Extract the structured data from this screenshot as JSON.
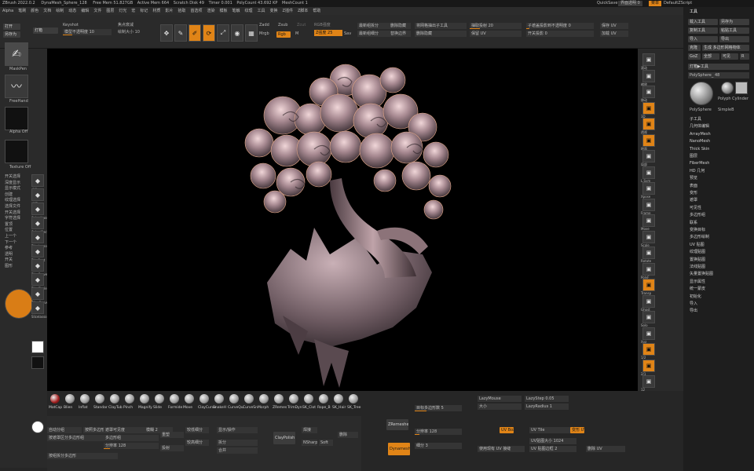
{
  "titlebar": {
    "app": "ZBrush 2022.0.2",
    "project": "DynaMesh_Sphere_128",
    "free_mem": "Free Mem 51.827GB",
    "active_mem": "Active Mem 664",
    "scratch": "Scratch Disk 49",
    "timer": "Timer 0.001",
    "polycount": "PolyCount 43.692 KP",
    "meshcount": "MeshCount 1",
    "quicksave": "QuickSave",
    "transparency": "界面透明 0",
    "menus_btn": "菜单",
    "script": "DefaultZScript"
  },
  "menubar": [
    "Alpha",
    "笔刷",
    "颜色",
    "文档",
    "绘制",
    "动态",
    "编辑",
    "文件",
    "图层",
    "灯光",
    "宏",
    "标记",
    "材质",
    "影片",
    "拾取",
    "首选项",
    "渲染",
    "模板",
    "笔触",
    "纹理",
    "工具",
    "变换",
    "Z插件",
    "Z脚本",
    "帮助"
  ],
  "toolbar": {
    "open": "打开",
    "saveas": "另存为",
    "lightbox": "灯箱",
    "keyshot": "Keyshot",
    "keyshot_sub": "模型不透明度 10",
    "move": "移动",
    "scale": "缩放",
    "rotate": "旋转",
    "edit": "Edit",
    "draw": "Draw",
    "zadd": "Zadd",
    "zsub": "Zsub",
    "zcut": "Zcut",
    "mrgb": "Mrgb",
    "rgb": "Rgb",
    "m": "M",
    "rgb_intensity": "RGB强度",
    "z_intensity": "Z强度 25",
    "focal": "焦点衰减",
    "draw_size": "绘制大小 10",
    "dynamic": "Dynamic",
    "ratio": "色彩强度 100",
    "pick": "拾取 1",
    "sub": "Sav",
    "lazy": "最新组拆分",
    "poly": "最新组细分",
    "copy_uv": "将网格抽出子工具",
    "unhide": "删除隐藏",
    "replace": "替换边界",
    "uv_smooth": "抽取投射 20",
    "keep_uv": "保留 UV",
    "fix": "子遮盖投影到不透明度 0",
    "switch_proj": "开关投影 0",
    "save": "保存 UV",
    "load": "加载 UV"
  },
  "left": {
    "brush": "MaskPen",
    "stroke": "FreeHand",
    "alpha": "Alpha Off",
    "texture": "Texture Off",
    "mat": "MatCap",
    "gradient": "渐变",
    "sss": "SSS",
    "front": "前台",
    "bg": "背景",
    "switch_color": "切换颜色",
    "pallette": "调色板",
    "symmetry": "对称",
    "cols": [
      "颜色",
      "标签",
      "SelectLasso",
      "SelectRect",
      "TrimLasso",
      "TrimRect",
      "TrimCurve",
      "TrimCircle",
      "SliceCurve",
      "Slicelasso",
      "Standard",
      "Blob",
      "Inflat",
      "Pinch",
      "Magnify"
    ],
    "labels": [
      "Fibremesh",
      "Dragdot",
      "Rect",
      "Circle",
      "Curve",
      "Dotted",
      "DragRect",
      "Spray",
      "Hibadist"
    ],
    "values": [
      "均值 1",
      "笔刷 64",
      "焦距 0",
      "R 0",
      "颜色分辨率 1",
      "焦点半径 1",
      "颜色分辨率 25",
      "角度 1",
      "强度 10",
      "MRes 64",
      "MSmooth 20",
      "重量 30",
      "MDcl 25",
      "Mindis 5"
    ],
    "panel": [
      "开关选择",
      "深度显示",
      "显示模式",
      "创建",
      "纹理选择",
      "选择文件",
      "开关选择",
      "字符选择",
      "置顶",
      "位置",
      "上一个",
      "下一个",
      "参考",
      "透明",
      "开关",
      "图形"
    ]
  },
  "right_shelf": [
    "滚动",
    "缩放",
    "移动",
    "3D",
    "透视",
    "地面",
    "局部",
    "L.Sym",
    "Xpose",
    "Frame",
    "Move",
    "Scale",
    "Rotate",
    "PolyF",
    "Transp",
    "Ghost",
    "Solo",
    "Xyz",
    "1/2",
    "2/1",
    "12",
    "34",
    "56"
  ],
  "right_tray": {
    "title": "工具",
    "load": "载入工具",
    "saveas": "另存为",
    "copy": "复制工具",
    "paste": "粘贴工具",
    "import": "导入",
    "export": "导出",
    "clone": "克隆",
    "make_poly": "生成 多边形网格物体",
    "goz": "GoZ",
    "all": "全部",
    "visible": "可见",
    "r": "R",
    "lightbox_tools": "灯箱▶工具",
    "polysphere": "PolySphere_ 48",
    "items": [
      "PolySphere",
      "Polyph Cylinder",
      "SimpleB",
      "Hibadist"
    ],
    "sections": [
      "子工具",
      "几何体编辑",
      "ArrayMesh",
      "NanoMesh",
      "Thick Skin",
      "图层",
      "FiberMesh",
      "HD 几何",
      "预览",
      "表面",
      "变形",
      "遮罩",
      "可见性",
      "多边形组",
      "联系",
      "变换目标",
      "多边形绘制",
      "UV 贴图",
      "纹理贴图",
      "置换贴图",
      "法线贴图",
      "矢量置换贴图",
      "显示属性",
      "统一蒙皮",
      "初始化",
      "导入",
      "导出"
    ]
  },
  "brushes": [
    "MatCap",
    "Blien",
    "Inflat",
    "Standar",
    "ClayTub",
    "Pinch",
    "Magnify",
    "Slide",
    "Formide",
    "Move",
    "ClayCurve",
    "SnakeH",
    "CurveQu",
    "CurveSn",
    "Morph",
    "ZRemes",
    "TrimDyn",
    "SK_Clot",
    "Rope_B",
    "SK_Hair",
    "SK_Tree"
  ],
  "bottom": {
    "auto_groups": "自动分组",
    "groups_split": "按照多边形分组",
    "group_vis": "遮罩可见度",
    "mask_by_poly": "按遮罩区分多边形组",
    "pollegroup": "多边形组",
    "reshape": "重塑",
    "bake": "显示/操作",
    "split": "拆分",
    "merge": "合并",
    "dynamesh": "Dynamesh",
    "zremesher": "ZRemesher",
    "polish": "ClayPolish",
    "weld": "焊接",
    "resolution": "分辨率 128",
    "blur": "模糊 2",
    "project": "投射",
    "lower": "较低细分",
    "higher": "较高细分",
    "target": "目标多边形数 5",
    "half": "一半",
    "same": "相同",
    "double": "两倍",
    "adapt": "自适应",
    "freeze": "冻结细分级别",
    "smooth": "平滑",
    "sharp": "NSharp",
    "soft": "Soft",
    "delete": "删除",
    "lazy": "LazyMouse",
    "lazy_step": "LazyStep 0.05",
    "lazy_smooth": "LazyRadius 1",
    "size": "大小",
    "pose": "姿势",
    "uv_map": "UV贴图大小 1024",
    "morph_uv": "变形 UV",
    "uvbox": "UV Box",
    "uvtile": "UV Tile",
    "use_poly": "使用现有 UV 接缝",
    "grid": "网格",
    "grid_size": "网格大小 20",
    "uv_mode": "UV 贴图边框 2",
    "count": "最小",
    "delete_uv": "删除 UV",
    "xyz": "加 XYZ",
    "subdiv": "细分 3",
    "dyna_res": "分辨率 128",
    "project_all": "投影全部",
    "accu": "精确度",
    "groups_poly": "按组拆分多边形"
  },
  "accent": "#e08417"
}
